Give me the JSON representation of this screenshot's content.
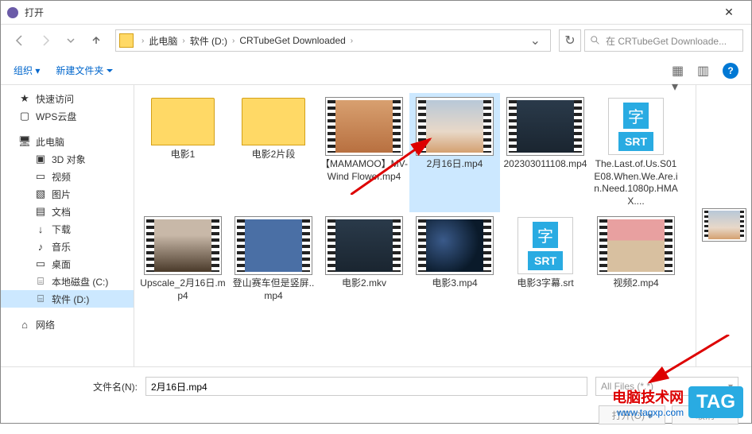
{
  "window": {
    "title": "打开"
  },
  "nav": {
    "path": [
      "此电脑",
      "软件 (D:)",
      "CRTubeGet Downloaded"
    ],
    "search_placeholder": "在 CRTubeGet Downloade..."
  },
  "toolbar": {
    "organize": "组织",
    "new_folder": "新建文件夹"
  },
  "sidebar": {
    "quick": "快速访问",
    "wps": "WPS云盘",
    "pc": "此电脑",
    "objects3d": "3D 对象",
    "videos": "视频",
    "pictures": "图片",
    "documents": "文档",
    "downloads": "下载",
    "music": "音乐",
    "desktop": "桌面",
    "drive_c": "本地磁盘 (C:)",
    "drive_d": "软件 (D:)",
    "network": "网络"
  },
  "files": {
    "f0": "电影1",
    "f1": "电影2片段",
    "f2": "【MAMAMOO】MV- Wind Flower.mp4",
    "f3": "2月16日.mp4",
    "f4": "202303011108.mp4",
    "f5": "The.Last.of.Us.S01E08.When.We.Are.in.Need.1080p.HMAX....",
    "f6": "Upscale_2月16日.mp4",
    "f7": "登山赛车但是竖屏..mp4",
    "f8": "电影2.mkv",
    "f9": "电影3.mp4",
    "f10": "电影3字幕.srt",
    "f11": "视频2.mp4",
    "srt_label": "SRT",
    "srt_char": "字"
  },
  "bottom": {
    "filename_label": "文件名(N):",
    "filename_value": "2月16日.mp4",
    "filetype": "All Files (*.*)",
    "open_btn": "打开(O)",
    "cancel_btn": "取消"
  },
  "watermark": {
    "cn": "电脑技术网",
    "url": "www.tagxp.com",
    "tag": "TAG"
  }
}
